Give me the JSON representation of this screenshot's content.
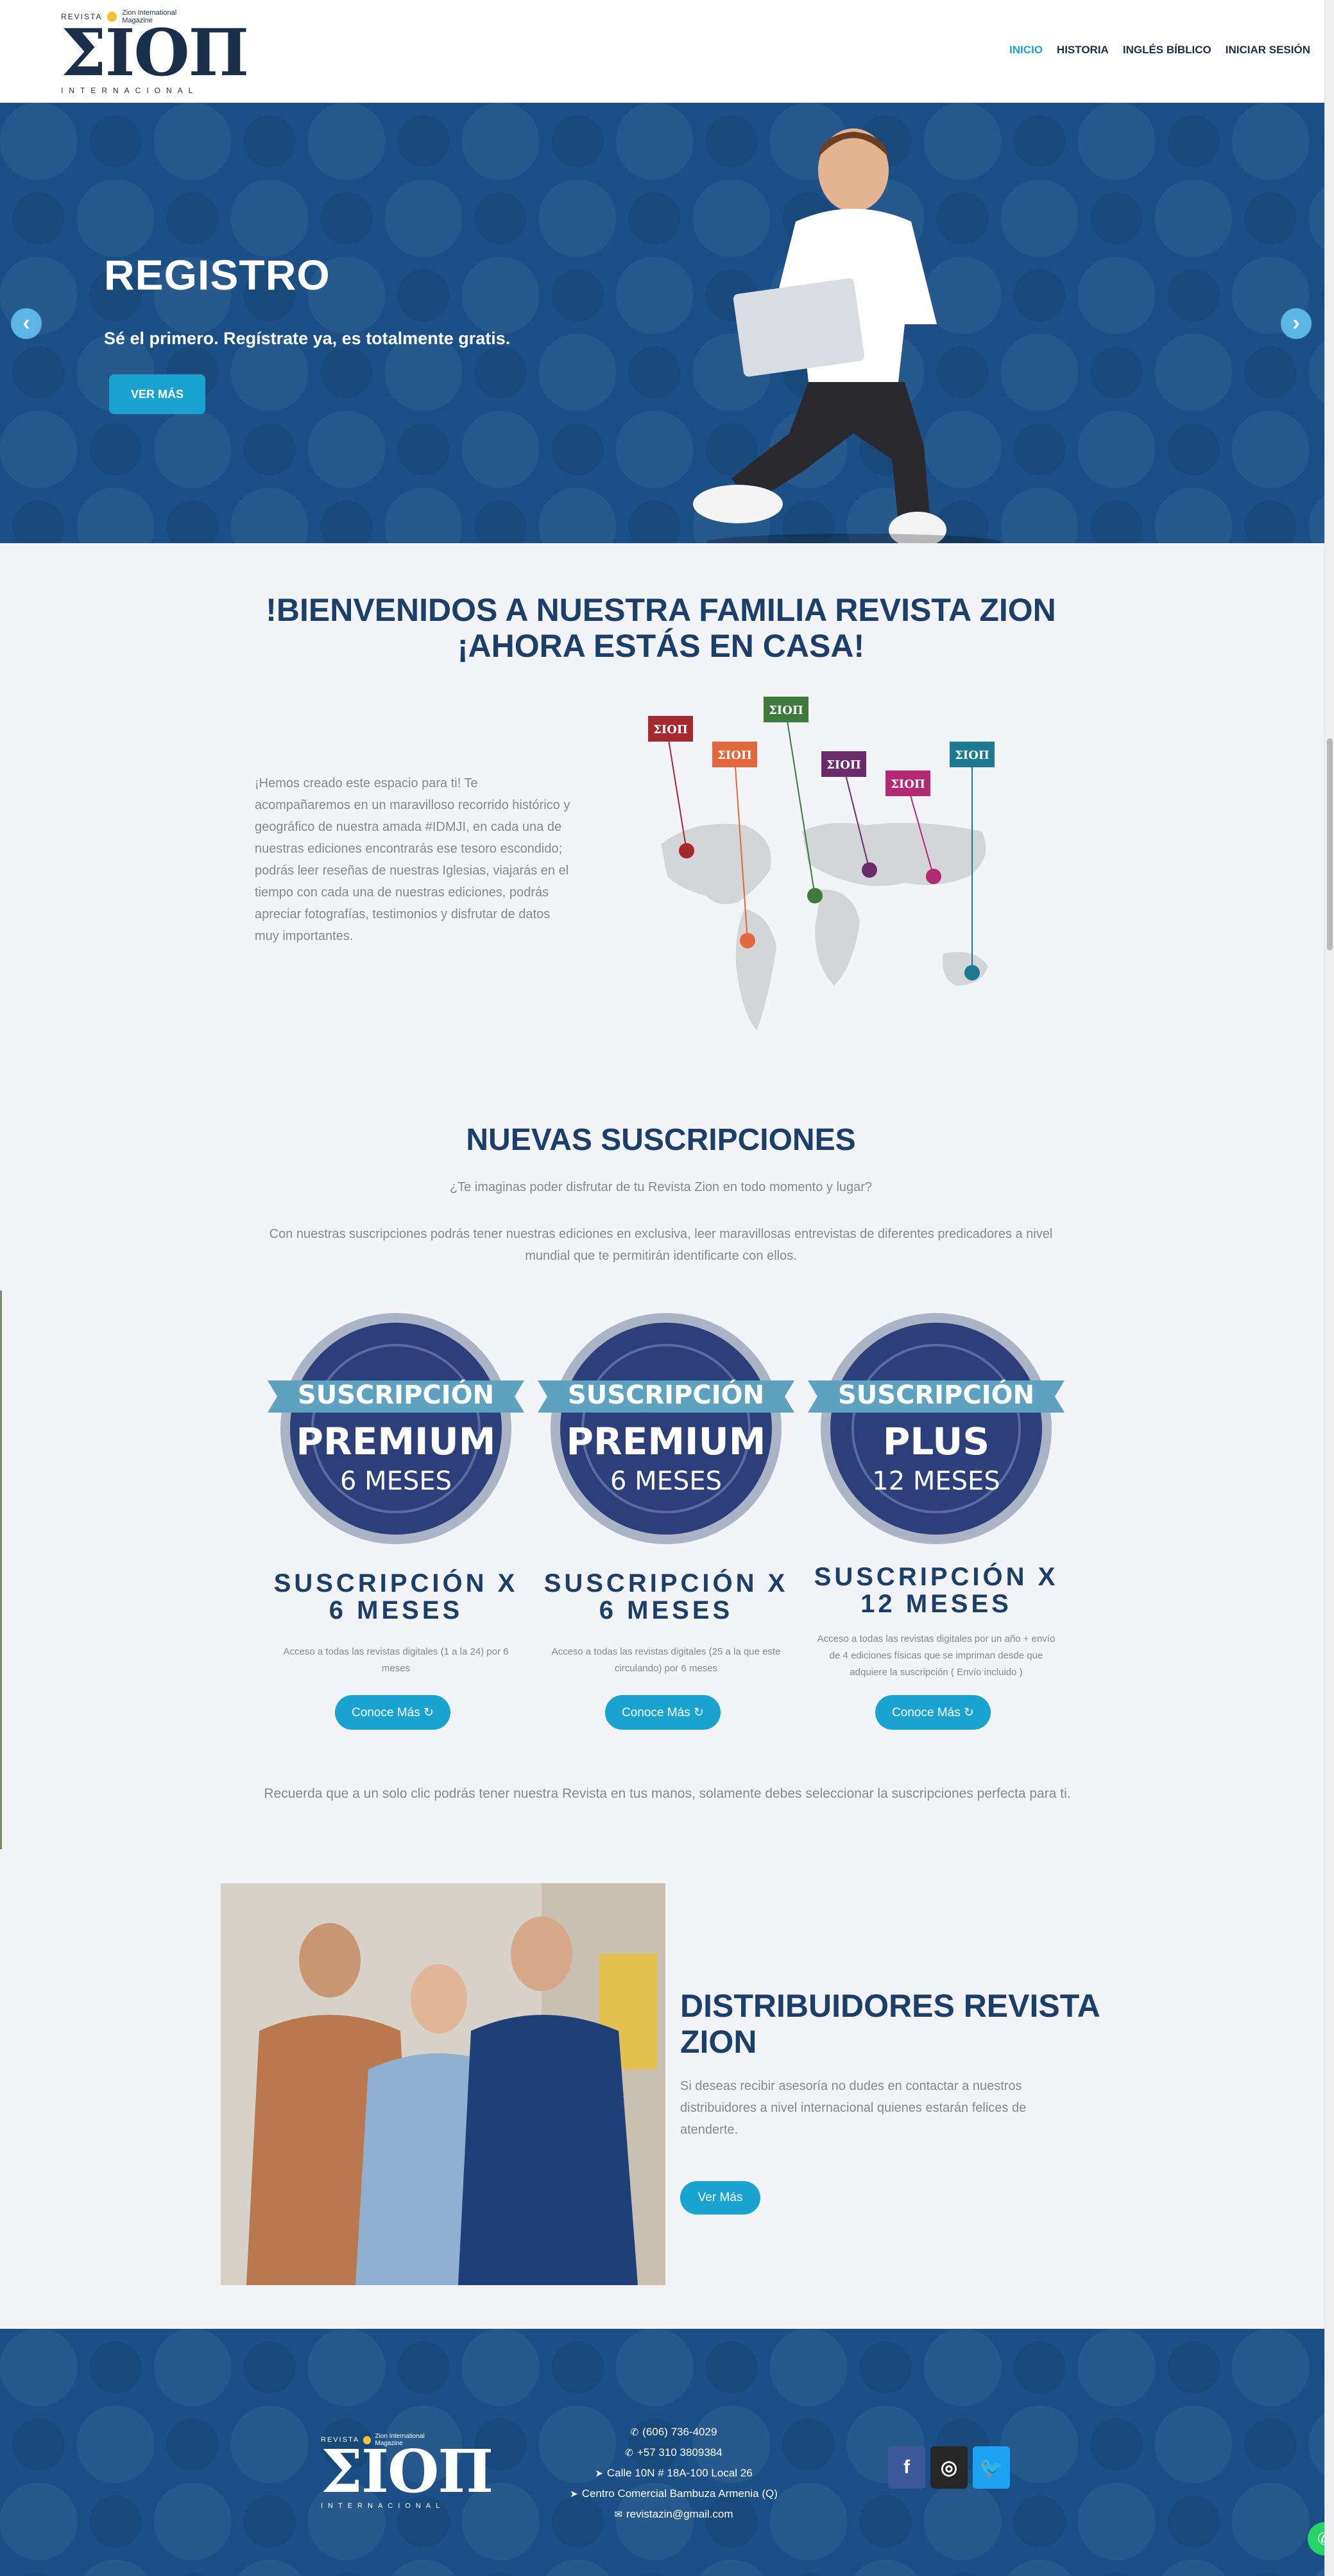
{
  "header": {
    "logo": {
      "top_text": "REVISTA",
      "tagline": "Zion International Magazine",
      "main": "ΣΙΟΠ",
      "bottom_text": "INTERNACIONAL"
    },
    "nav": [
      "INICIO",
      "HISTORIA",
      "INGLÉS BÍBLICO",
      "INICIAR SESIÓN"
    ],
    "active_nav": "INICIO"
  },
  "hero": {
    "title": "REGISTRO",
    "subtitle": "Sé el primero. Regístrate ya, es totalmente gratis.",
    "button": "VER MÁS",
    "prev_glyph": "‹",
    "next_glyph": "›"
  },
  "welcome": {
    "title_line1": "!BIENVENIDOS A NUESTRA FAMILIA REVISTA ZION",
    "title_line2": "¡AHORA ESTÁS EN CASA!",
    "text": "¡Hemos creado este espacio para ti! Te acompañaremos en un maravilloso recorrido histórico y geográfico de nuestra amada #IDMJI, en cada una de nuestras ediciones encontrarás ese tesoro escondido; podrás leer reseñas de nuestras Iglesias, viajarás en el tiempo con cada una de nuestras ediciones, podrás apreciar fotografías, testimonios y disfrutar de datos muy importantes.",
    "map_flags": [
      "ΣΙΟΠ",
      "ΣΙΟΠ",
      "ΣΙΟΠ",
      "ΣΙΟΠ",
      "ΣΙΟΠ",
      "ΣΙΟΠ"
    ]
  },
  "subscriptions": {
    "title": "NUEVAS SUSCRIPCIONES",
    "question": "¿Te imaginas poder disfrutar de tu Revista Zion en todo momento y lugar?",
    "description": "Con nuestras suscripciones podrás tener nuestras ediciones en exclusiva, leer maravillosas entrevistas de diferentes predicadores a nivel mundial que te permitirán identificarte con ellos.",
    "cards": [
      {
        "badge_ribbon": "SUSCRIPCIÓN",
        "badge_main": "PREMIUM",
        "badge_sub": "6 MESES",
        "title": "SUSCRIPCIÓN X 6 MESES",
        "desc": "Acceso a todas las revistas digitales (1 a la 24) por 6 meses",
        "button": "Conoce Más ↻"
      },
      {
        "badge_ribbon": "SUSCRIPCIÓN",
        "badge_main": "PREMIUM",
        "badge_sub": "6 MESES",
        "title": "SUSCRIPCIÓN X 6 MESES",
        "desc": "Acceso a todas las revistas digitales (25 a la que este circulando) por 6 meses",
        "button": "Conoce Más ↻"
      },
      {
        "badge_ribbon": "SUSCRIPCIÓN",
        "badge_main": "PLUS",
        "badge_sub": "12 MESES",
        "title": "SUSCRIPCIÓN X 12 MESES",
        "desc": "Acceso a todas las revistas digitales por un año + envío de 4 ediciones físicas que se impriman desde que adquiere la suscripción ( Envío incluido )",
        "button": "Conoce Más ↻"
      }
    ],
    "note": "Recuerda que a un solo clic podrás tener nuestra Revista en tus manos, solamente debes seleccionar la suscripciones perfecta para ti."
  },
  "distributors": {
    "title": "DISTRIBUIDORES REVISTA ZION",
    "text": "Si deseas recibir asesoría no dudes en contactar a nuestros distribuidores a nivel internacional quienes estarán felices de atenderte.",
    "button": "Ver Más"
  },
  "footer": {
    "logo": {
      "top_text": "REVISTA",
      "tagline": "Zion International Magazine",
      "main": "ΣΙΟΠ",
      "bottom_text": "INTERNACIONAL"
    },
    "contacts": [
      {
        "icon": "phone-icon",
        "glyph": "✆",
        "text": "(606) 736-4029"
      },
      {
        "icon": "phone-icon",
        "glyph": "✆",
        "text": "+57 310 3809384"
      },
      {
        "icon": "location-arrow-icon",
        "glyph": "➤",
        "text": "Calle 10N # 18A-100 Local 26"
      },
      {
        "icon": "location-arrow-icon",
        "glyph": "➤",
        "text": "Centro Comercial Bambuza Armenia (Q)"
      },
      {
        "icon": "envelope-icon",
        "glyph": "✉",
        "text": "revistazin@gmail.com"
      }
    ],
    "social": [
      {
        "name": "facebook-icon",
        "glyph": "f",
        "color": "#3b5998"
      },
      {
        "name": "instagram-icon",
        "glyph": "◎",
        "color": "#262626"
      },
      {
        "name": "twitter-icon",
        "glyph": "🐦",
        "color": "#1da1f2"
      }
    ]
  },
  "colors": {
    "accent": "#1aa2d0",
    "navy": "#1b3f6a",
    "hero_blue": "#1b4f86"
  }
}
